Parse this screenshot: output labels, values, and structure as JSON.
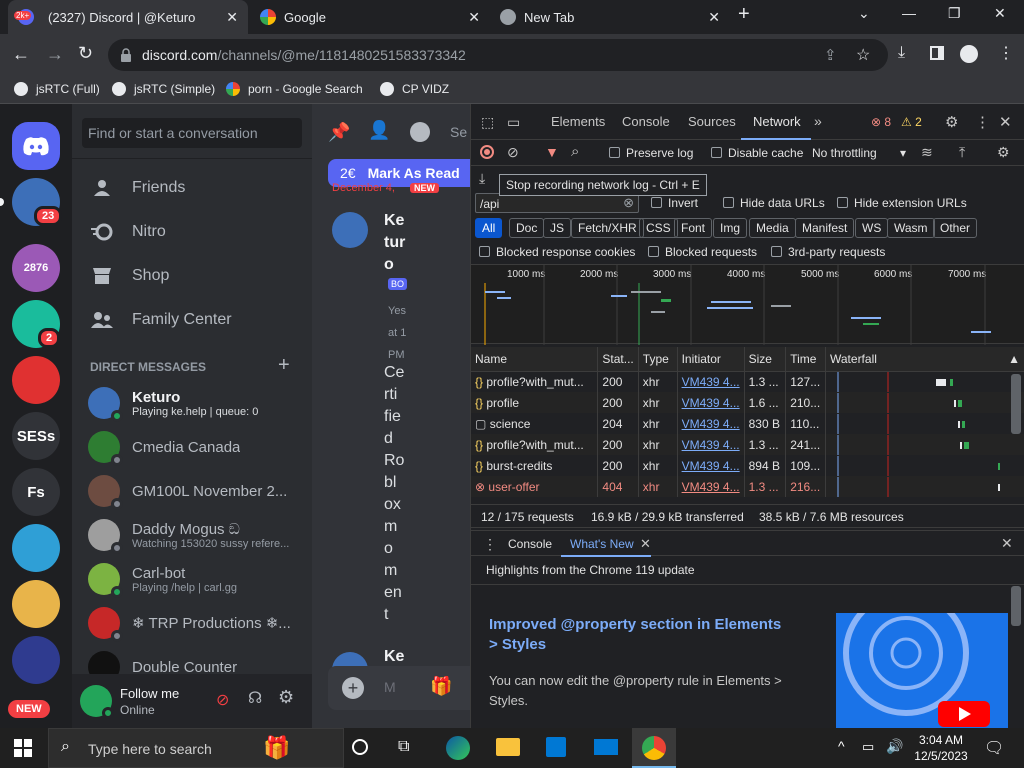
{
  "browser": {
    "tabs": [
      {
        "label": "(2327) Discord | @Keturo",
        "badge": "2k+",
        "active": true
      },
      {
        "label": "Google",
        "active": false
      },
      {
        "label": "New Tab",
        "active": false
      }
    ],
    "url_host": "discord.com",
    "url_path": "/channels/@me/1181480251583373342",
    "bookmarks": [
      "jsRTC (Full)",
      "jsRTC (Simple)",
      "porn - Google Search",
      "CP VIDZ"
    ]
  },
  "servers": [
    {
      "label": "",
      "badge": "23"
    },
    {
      "label": "",
      "badge": ""
    },
    {
      "label": "",
      "badge": "2"
    },
    {
      "label": "",
      "badge": ""
    },
    {
      "label": "SESs",
      "badge": ""
    },
    {
      "label": "Fs",
      "badge": ""
    },
    {
      "label": "",
      "badge": ""
    },
    {
      "label": "",
      "badge": ""
    },
    {
      "label": "",
      "badge": ""
    },
    {
      "label": "NEW",
      "badge": ""
    }
  ],
  "dm_sidebar": {
    "search_placeholder": "Find or start a conversation",
    "nav": [
      "Friends",
      "Nitro",
      "Shop",
      "Family Center"
    ],
    "section_title": "DIRECT MESSAGES",
    "dms": [
      {
        "name": "Keturo",
        "activity": "Playing ke.help | queue: 0",
        "status": "#23a55a"
      },
      {
        "name": "Cmedia Canada",
        "activity": "",
        "status": "#80848e"
      },
      {
        "name": "GM100L November 2...",
        "activity": "",
        "status": "#80848e"
      },
      {
        "name": "Daddy Mogus ඞ",
        "activity": "Watching 153020 sussy refere...",
        "status": "#80848e"
      },
      {
        "name": "Carl-bot",
        "activity": "Playing /help | carl.gg",
        "status": "#23a55a"
      },
      {
        "name": "❄ TRP Productions ❄...",
        "activity": "",
        "status": "#80848e"
      },
      {
        "name": "Double Counter",
        "activity": "",
        "status": "#80848e"
      }
    ],
    "user": {
      "name": "Follow me",
      "status": "Online"
    }
  },
  "chat": {
    "unread_count": "2€",
    "mark_as_read": "Mark As Read",
    "date_divider": "December 4,",
    "new_label": "NEW",
    "author_letters": [
      "Ke",
      "tur",
      "o"
    ],
    "bot_tag": "BO",
    "time_parts": [
      "Yes",
      "at 1",
      "PM"
    ],
    "message_letters": [
      "Ce",
      "rti",
      "fie",
      "d",
      "Ro",
      "bl",
      "ox",
      "m",
      "o",
      "m",
      "en",
      "t"
    ],
    "next_author": "Ke",
    "input_placeholder": "M"
  },
  "devtools": {
    "tabs": [
      "Elements",
      "Console",
      "Sources",
      "Network"
    ],
    "errors": "8",
    "warnings": "2",
    "preserve_log": "Preserve log",
    "disable_cache": "Disable cache",
    "throttling": "No throttling",
    "tooltip": "Stop recording network log - Ctrl + E",
    "filter_value": "/api",
    "invert": "Invert",
    "hide_data_urls": "Hide data URLs",
    "hide_ext_urls": "Hide extension URLs",
    "types": [
      "All",
      "Doc",
      "JS",
      "Fetch/XHR",
      "CSS",
      "Font",
      "Img",
      "Media",
      "Manifest",
      "WS",
      "Wasm",
      "Other"
    ],
    "blocked_cookies": "Blocked response cookies",
    "blocked_requests": "Blocked requests",
    "third_party": "3rd-party requests",
    "timeline_ticks": [
      "1000 ms",
      "2000 ms",
      "3000 ms",
      "4000 ms",
      "5000 ms",
      "6000 ms",
      "7000 ms"
    ],
    "columns": [
      "Name",
      "Stat...",
      "Type",
      "Initiator",
      "Size",
      "Time",
      "Waterfall"
    ],
    "rows": [
      {
        "name": "profile?with_mut...",
        "status": "200",
        "type": "xhr",
        "initiator": "VM439 4...",
        "size": "1.3 ...",
        "time": "127..."
      },
      {
        "name": "profile",
        "status": "200",
        "type": "xhr",
        "initiator": "VM439 4...",
        "size": "1.6 ...",
        "time": "210..."
      },
      {
        "name": "science",
        "status": "204",
        "type": "xhr",
        "initiator": "VM439 4...",
        "size": "830 B",
        "time": "110..."
      },
      {
        "name": "profile?with_mut...",
        "status": "200",
        "type": "xhr",
        "initiator": "VM439 4...",
        "size": "1.3 ...",
        "time": "241..."
      },
      {
        "name": "burst-credits",
        "status": "200",
        "type": "xhr",
        "initiator": "VM439 4...",
        "size": "894 B",
        "time": "109..."
      },
      {
        "name": "user-offer",
        "status": "404",
        "type": "xhr",
        "initiator": "VM439 4...",
        "size": "1.3 ...",
        "time": "216..."
      }
    ],
    "summary_requests": "12 / 175 requests",
    "summary_transferred": "16.9 kB / 29.9 kB transferred",
    "summary_resources": "38.5 kB / 7.6 MB resources",
    "drawer_tabs": [
      "Console",
      "What's New"
    ],
    "whatsnew_header": "Highlights from the Chrome 119 update",
    "article_title": "Improved @property section in Elements > Styles",
    "article_body": "You can now edit the @property rule in Elements > Styles."
  },
  "taskbar": {
    "search_placeholder": "Type here to search",
    "time": "3:04 AM",
    "date": "12/5/2023"
  }
}
